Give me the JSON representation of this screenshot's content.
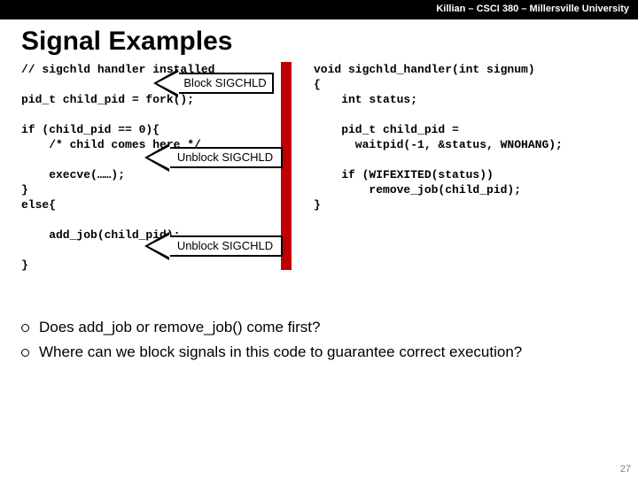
{
  "header": "Killian – CSCI 380 – Millersville University",
  "title": "Signal Examples",
  "code_left": "// sigchld handler installed\n\npid_t child_pid = fork();\n\nif (child_pid == 0){\n    /* child comes here */\n\n    execve(……);\n}\nelse{\n\n    add_job(child_pid);\n\n}",
  "code_right": "void sigchld_handler(int signum)\n{\n    int status;\n\n    pid_t child_pid =\n      waitpid(-1, &status, WNOHANG);\n\n    if (WIFEXITED(status))\n        remove_job(child_pid);\n}",
  "arrows": {
    "a1": "Block SIGCHLD",
    "a2": "Unblock SIGCHLD",
    "a3": "Unblock SIGCHLD"
  },
  "bullets": {
    "b1": "Does add_job or remove_job() come first?",
    "b2": "Where can we block signals in this code to guarantee correct execution?"
  },
  "page": "27"
}
